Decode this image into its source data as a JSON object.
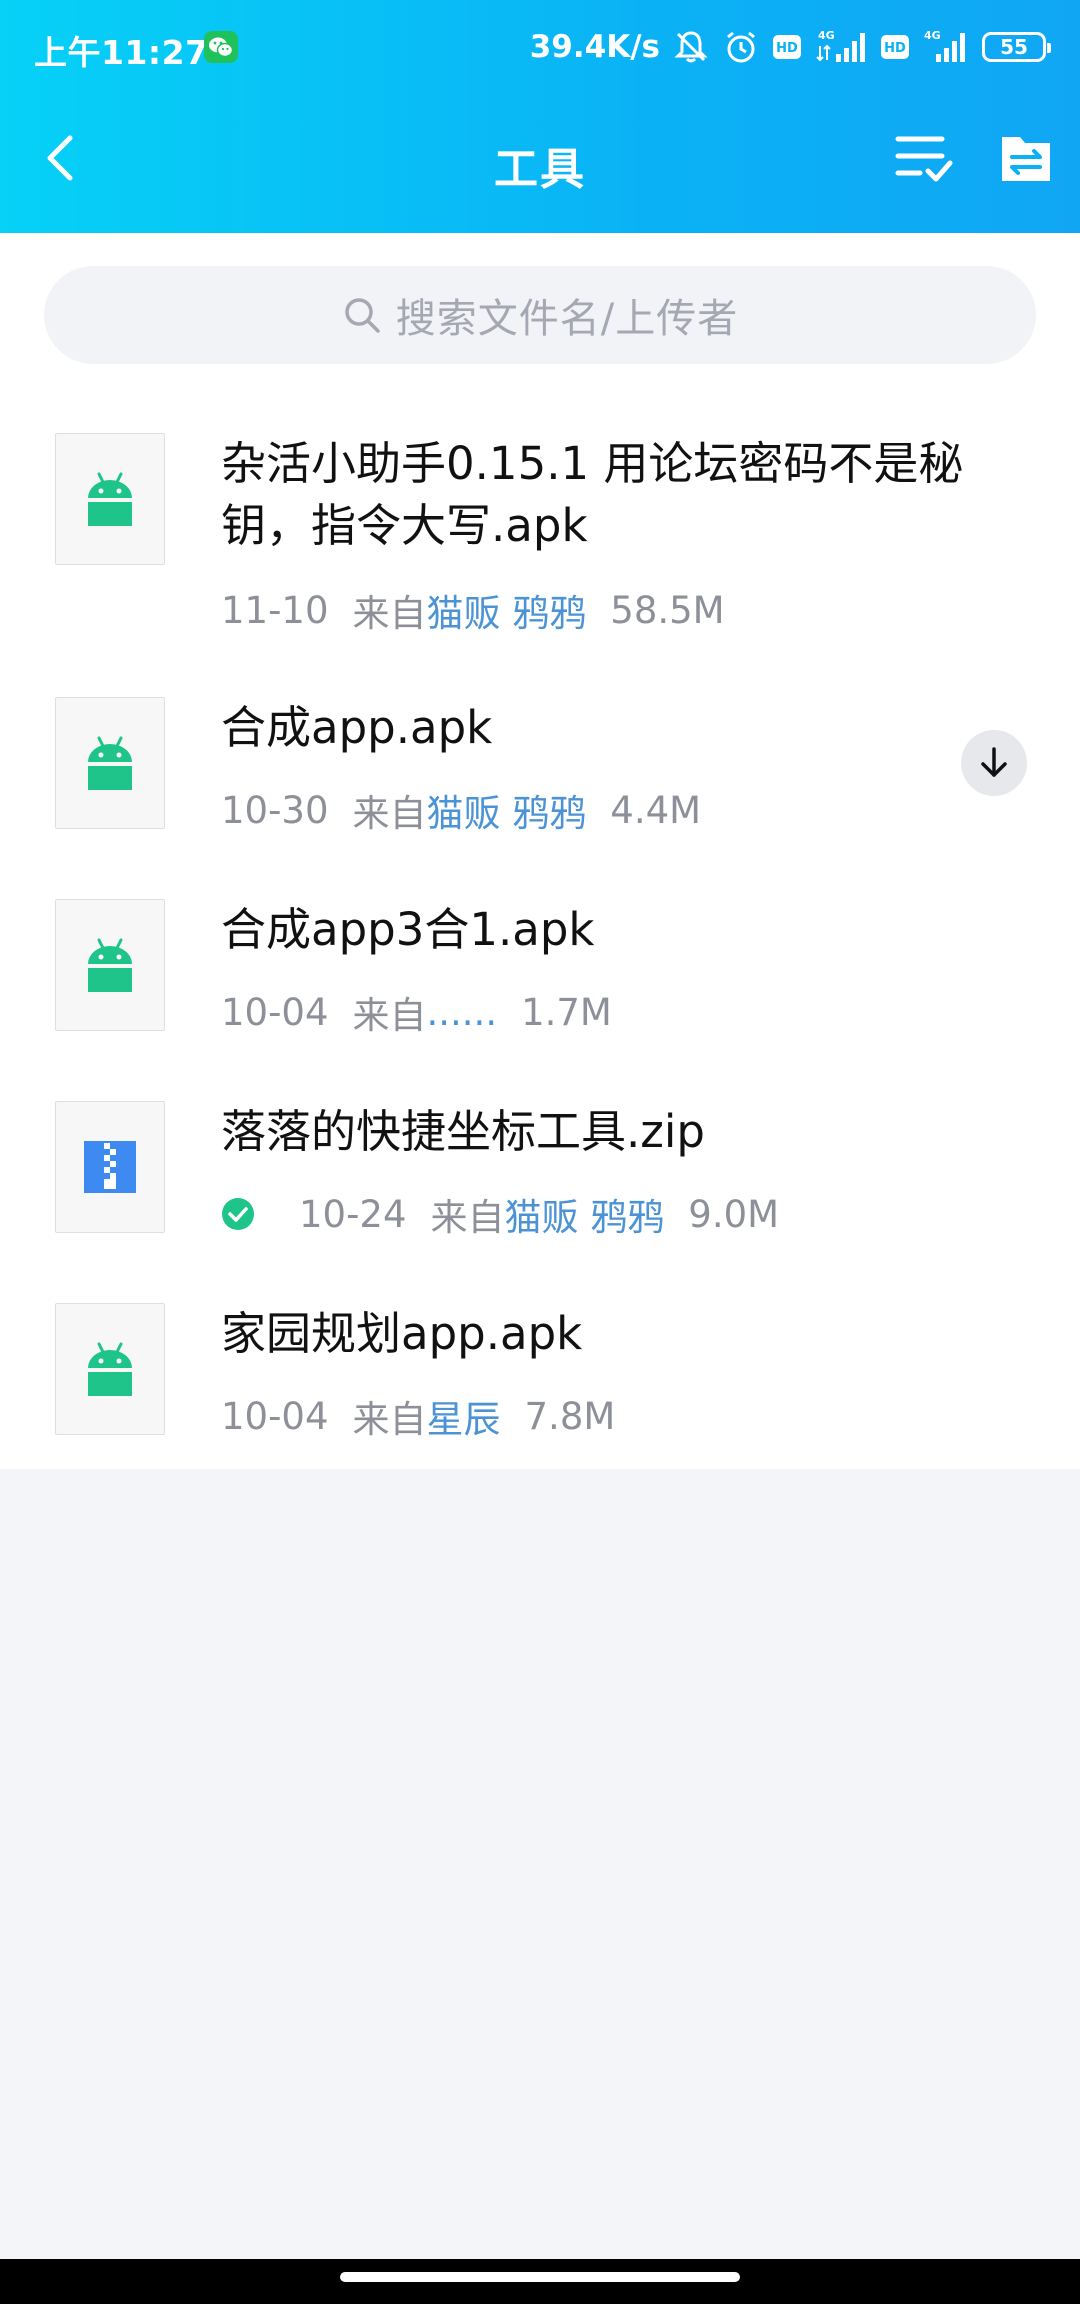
{
  "status_bar": {
    "time": "上午11:27",
    "net_speed": "39.4K/s",
    "hd_label": "HD",
    "network": "4G",
    "battery": "55"
  },
  "nav": {
    "title": "工具"
  },
  "search": {
    "placeholder": "搜索文件名/上传者"
  },
  "files": [
    {
      "name": "杂活小助手0.15.1 用论坛密码不是秘钥，指令大写.apk",
      "date": "11-10",
      "from_label": "来自",
      "uploader": "猫贩 鸦鸦",
      "size": "58.5M",
      "icon": "android-icon"
    },
    {
      "name": "合成app.apk",
      "date": "10-30",
      "from_label": "来自",
      "uploader": "猫贩 鸦鸦",
      "size": "4.4M",
      "icon": "android-icon",
      "action": "download-icon"
    },
    {
      "name": "合成app3合1.apk",
      "date": "10-04",
      "from_label": "来自",
      "uploader": "......",
      "size": "1.7M",
      "icon": "android-icon"
    },
    {
      "name": "落落的快捷坐标工具.zip",
      "date": "10-24",
      "from_label": "来自",
      "uploader": "猫贩 鸦鸦",
      "size": "9.0M",
      "icon": "zip-icon",
      "status": "downloaded-check-icon"
    },
    {
      "name": "家园规划app.apk",
      "date": "10-04",
      "from_label": "来自",
      "uploader": "星辰",
      "size": "7.8M",
      "icon": "android-icon"
    }
  ],
  "colors": {
    "header_start": "#06d1f7",
    "header_end": "#10a6f4",
    "android_green": "#1fc48a",
    "zip_blue": "#3d8af0",
    "uploader_link": "#4c93d6",
    "meta_gray": "#8d9099"
  }
}
